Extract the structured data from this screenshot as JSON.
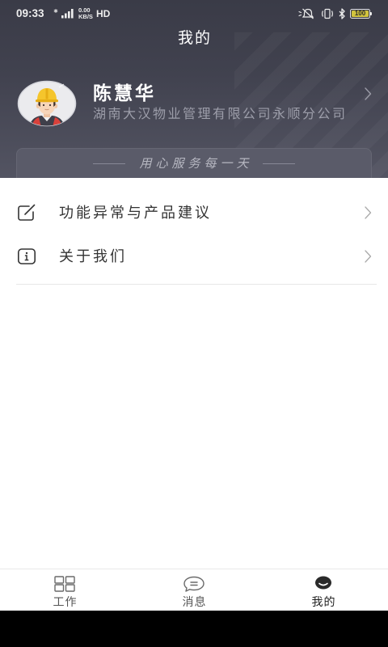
{
  "status_bar": {
    "time": "09:33",
    "net_speed_value": "0.00",
    "net_speed_unit": "KB/S",
    "hd_label": "HD",
    "battery_level": "100",
    "icons": [
      "signal-icon",
      "silent-mode-icon",
      "vibrate-icon",
      "bluetooth-icon",
      "battery-icon"
    ]
  },
  "header": {
    "title": "我的"
  },
  "profile": {
    "name": "陈慧华",
    "company": "湖南大汉物业管理有限公司永顺分公司",
    "avatar_icon": "worker-avatar-icon",
    "chevron_icon": "chevron-right-icon"
  },
  "banner": {
    "slogan": "用心服务每一天"
  },
  "menu": {
    "items": [
      {
        "label": "功能异常与产品建议",
        "icon": "edit-icon"
      },
      {
        "label": "关于我们",
        "icon": "info-icon"
      }
    ]
  },
  "tab_bar": {
    "tabs": [
      {
        "label": "工作",
        "icon": "grid-icon",
        "active": false
      },
      {
        "label": "消息",
        "icon": "chat-bubble-icon",
        "active": false
      },
      {
        "label": "我的",
        "icon": "face-icon",
        "active": true
      }
    ]
  },
  "colors": {
    "header_top": "#3a3b47",
    "header_bottom": "#535462",
    "banner_bg": "#5a5b69",
    "subtitle": "#9d9eaa",
    "slogan": "#b6b7c1",
    "text_primary": "#333333",
    "tab_inactive": "#555555",
    "tab_active": "#1e1e1e",
    "battery_fill": "#d2c43e"
  }
}
